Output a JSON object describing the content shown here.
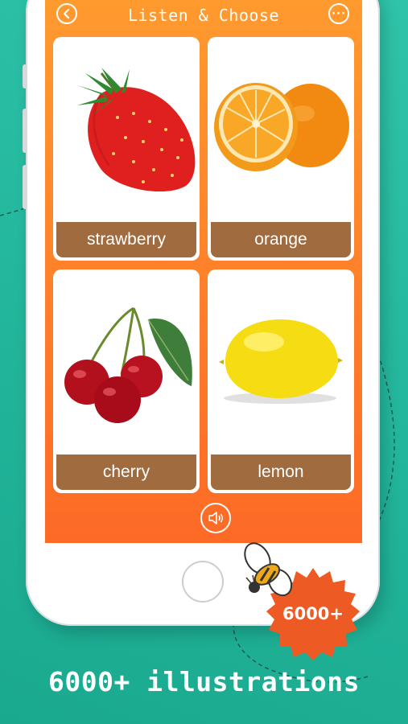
{
  "header": {
    "title": "Listen & Choose",
    "back_icon": "chevron-left-icon",
    "more_icon": "more-dots-icon",
    "more_label": "···"
  },
  "cards": [
    {
      "label": "strawberry",
      "icon": "strawberry-illustration"
    },
    {
      "label": "orange",
      "icon": "orange-illustration"
    },
    {
      "label": "cherry",
      "icon": "cherry-illustration"
    },
    {
      "label": "lemon",
      "icon": "lemon-illustration"
    }
  ],
  "sound_button": {
    "icon": "speaker-icon"
  },
  "badge": {
    "text": "6000+"
  },
  "caption": "6000+ illustrations",
  "colors": {
    "background": "#22b59b",
    "screen_top": "#ff9a2e",
    "screen_bottom": "#fd6a26",
    "label_bg": "#a06b3f",
    "badge": "#ee5a24"
  }
}
